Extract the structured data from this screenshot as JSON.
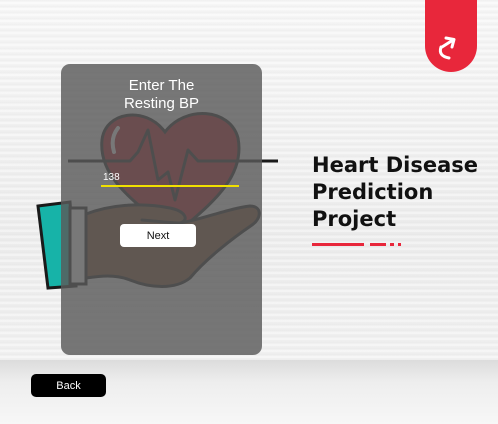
{
  "form": {
    "prompt": "Enter The\nResting BP",
    "bp_value": "138",
    "next_label": "Next"
  },
  "project": {
    "title": "Heart Disease Prediction Project"
  },
  "nav": {
    "back_label": "Back"
  },
  "icons": {
    "logo": "brand-logo-icon",
    "illustration": "hand-holding-heart-icon"
  },
  "colors": {
    "brand_red": "#e8273b",
    "panel": "#5a5a5a",
    "input_underline": "#f0e000",
    "back_button": "#000000"
  }
}
